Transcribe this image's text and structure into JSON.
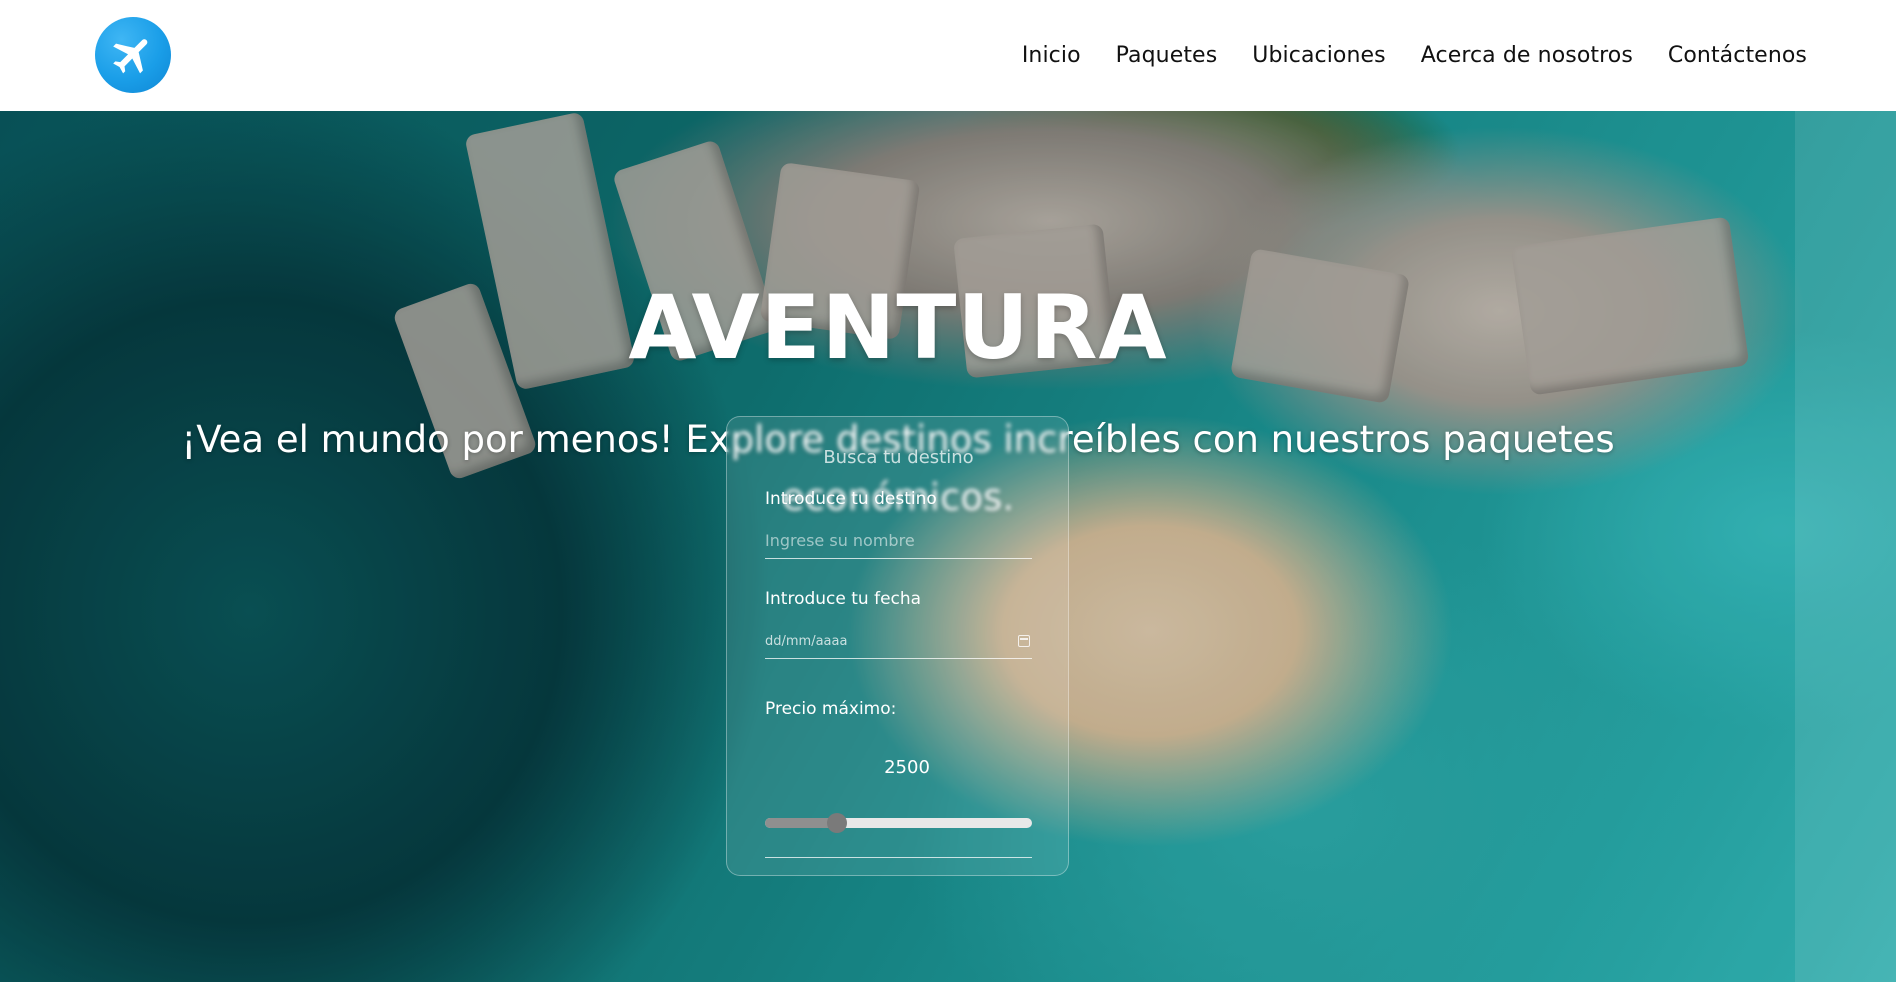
{
  "header": {
    "logo_icon": "airplane-icon",
    "nav": [
      {
        "label": "Inicio"
      },
      {
        "label": "Paquetes"
      },
      {
        "label": "Ubicaciones"
      },
      {
        "label": "Acerca de nosotros"
      },
      {
        "label": "Contáctenos"
      }
    ]
  },
  "hero": {
    "title": "AVENTURA",
    "subtitle": "¡Vea el mundo por menos! Explore destinos increíbles con nuestros paquetes económicos."
  },
  "search": {
    "title": "Busca tu destino",
    "destination_label": "Introduce tu destino",
    "destination_placeholder": "Ingrese su nombre",
    "date_label": "Introduce tu fecha",
    "date_placeholder": "dd/mm/aaaa",
    "price_label": "Precio máximo:",
    "price_value": "2500",
    "price_slider_fraction": 0.27
  },
  "colors": {
    "accent": "#1a9ee8",
    "nav_text": "#111111"
  }
}
